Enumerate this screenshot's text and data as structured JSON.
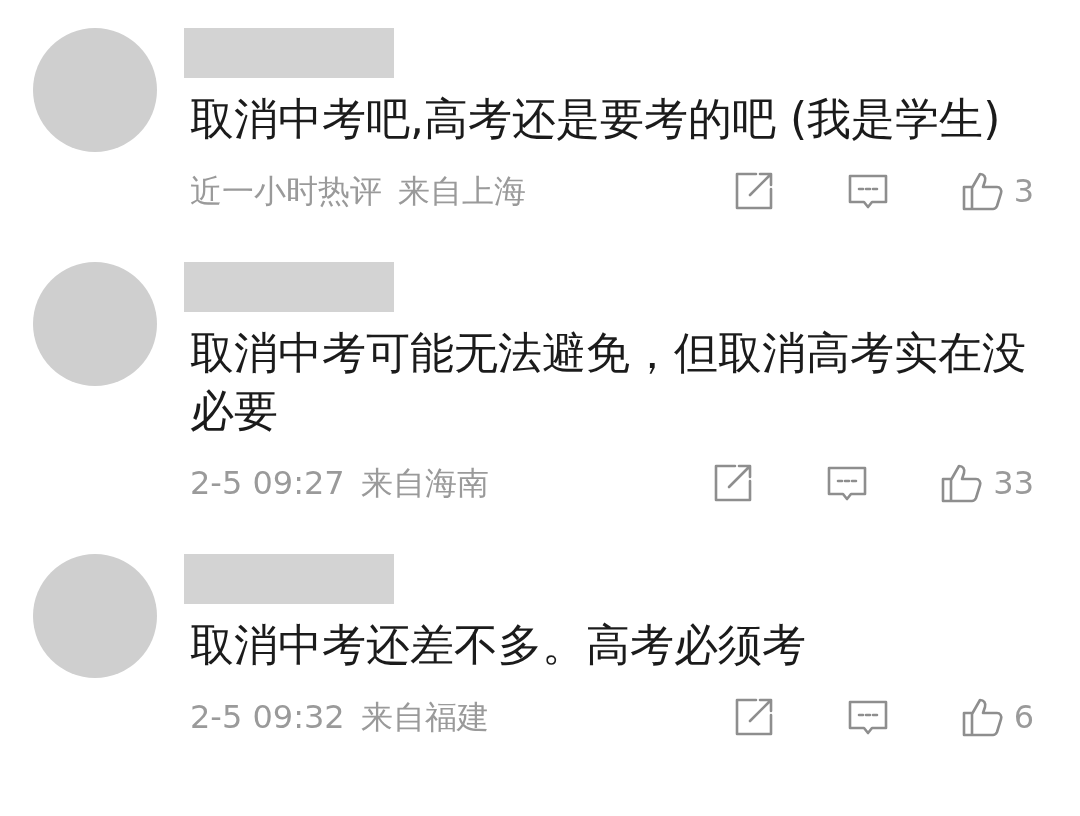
{
  "comments": [
    {
      "text": "取消中考吧,高考还是要考的吧 (我是学生)",
      "time": "近一小时热评",
      "location": "来自上海",
      "likes": "3"
    },
    {
      "text": "取消中考可能无法避免，但取消高考实在没必要",
      "time": "2-5 09:27",
      "location": "来自海南",
      "likes": "33"
    },
    {
      "text": "取消中考还差不多。高考必须考",
      "time": "2-5 09:32",
      "location": "来自福建",
      "likes": "6"
    }
  ]
}
